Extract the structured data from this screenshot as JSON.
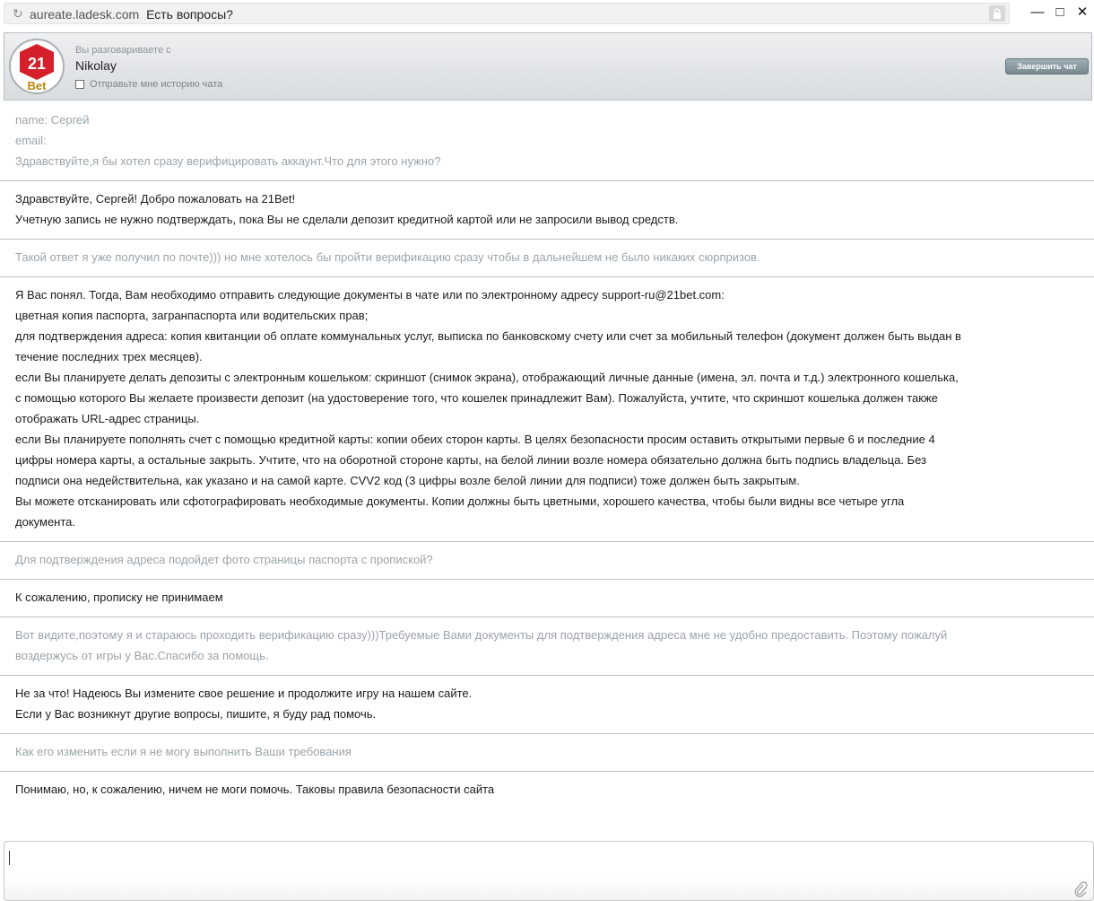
{
  "browser": {
    "host": "aureate.ladesk.com",
    "title": "Есть вопросы?"
  },
  "header": {
    "avatar_top": "21",
    "avatar_bottom": "Bet",
    "talking_to_label": "Вы разговариваете с",
    "agent_name": "Nikolay",
    "send_history_label": "Отправьте мне историю чата",
    "end_chat_label": "Завершить чат"
  },
  "messages": [
    {
      "sender": "visitor",
      "lines": [
        "name: Сергей",
        "email:",
        "Здравствуйте,я бы хотел сразу верифицировать аккаунт.Что для этого нужно?"
      ]
    },
    {
      "sender": "agent",
      "lines": [
        "Здравствуйте, Сергей! Добро пожаловать на 21Bet!",
        "Учетную запись не нужно подтверждать, пока Вы не сделали депозит кредитной картой или не запросили вывод средств."
      ]
    },
    {
      "sender": "visitor",
      "lines": [
        "Такой ответ я уже получил по почте))) но мне хотелось бы пройти верификацию сразу чтобы в дальнейшем не было никаких сюрпризов."
      ]
    },
    {
      "sender": "agent",
      "lines": [
        "Я Вас понял. Тогда, Вам необходимо отправить следующие документы в чате или по электронному адресу support-ru@21bet.com:",
        "цветная копия паспорта, загранпаспорта или водительских прав;",
        "для подтверждения адреса: копия квитанции об оплате коммунальных услуг, выписка по банковскому счету или счет за мобильный телефон (документ должен быть выдан в",
        "течение последних трех месяцев).",
        "если Вы планируете делать депозиты с электронным кошельком: скриншот (снимок экрана), отображающий личные данные (имена, эл. почта и т.д.) электронного кошелька,",
        "с помощью которого Вы желаете произвести депозит (на удостоверение того, что кошелек принадлежит Вам). Пожалуйста, учтите, что скриншот кошелька должен также",
        "отображать URL-адрес страницы.",
        "если Вы планируете пополнять счет с помощью кредитной карты: копии обеих сторон карты. В целях безопасности просим оставить открытыми первые 6 и последние 4",
        "цифры номера карты, а остальные закрыть. Учтите, что на оборотной стороне карты, на белой линии возле номера обязательно должна быть подпись владельца. Без",
        "подписи она недействительна, как указано и на самой карте. CVV2 код (3 цифры возле белой линии для подписи) тоже должен быть закрытым.",
        "Вы можете отсканировать или сфотографировать необходимые документы. Копии должны быть цветными, хорошего качества, чтобы были видны все четыре угла",
        "документа."
      ]
    },
    {
      "sender": "visitor",
      "lines": [
        "Для подтверждения адреса подойдет фото страницы паспорта с пропиской?"
      ]
    },
    {
      "sender": "agent",
      "lines": [
        "К сожалению, прописку не принимаем"
      ]
    },
    {
      "sender": "visitor",
      "lines": [
        "Вот видите,поэтому я и стараюсь проходить верификацию сразу)))Требуемые Вами документы для подтверждения адреса мне не удобно предоставить. Поэтому пожалуй",
        "воздержусь от игры у Вас.Спасибо за помощь."
      ]
    },
    {
      "sender": "agent",
      "lines": [
        "Не за что! Надеюсь Вы измените свое решение и продолжите игру на нашем сайте.",
        "Если у Вас возникнут другие вопросы, пишите, я буду рад помочь."
      ]
    },
    {
      "sender": "visitor",
      "lines": [
        "Как его изменить если я не могу выполнить Ваши требования"
      ]
    },
    {
      "sender": "agent",
      "lines": [
        "Понимаю, но, к сожалению, ничем не моги помочь. Таковы правила безопасности сайта"
      ]
    }
  ],
  "input": {
    "value": ""
  }
}
